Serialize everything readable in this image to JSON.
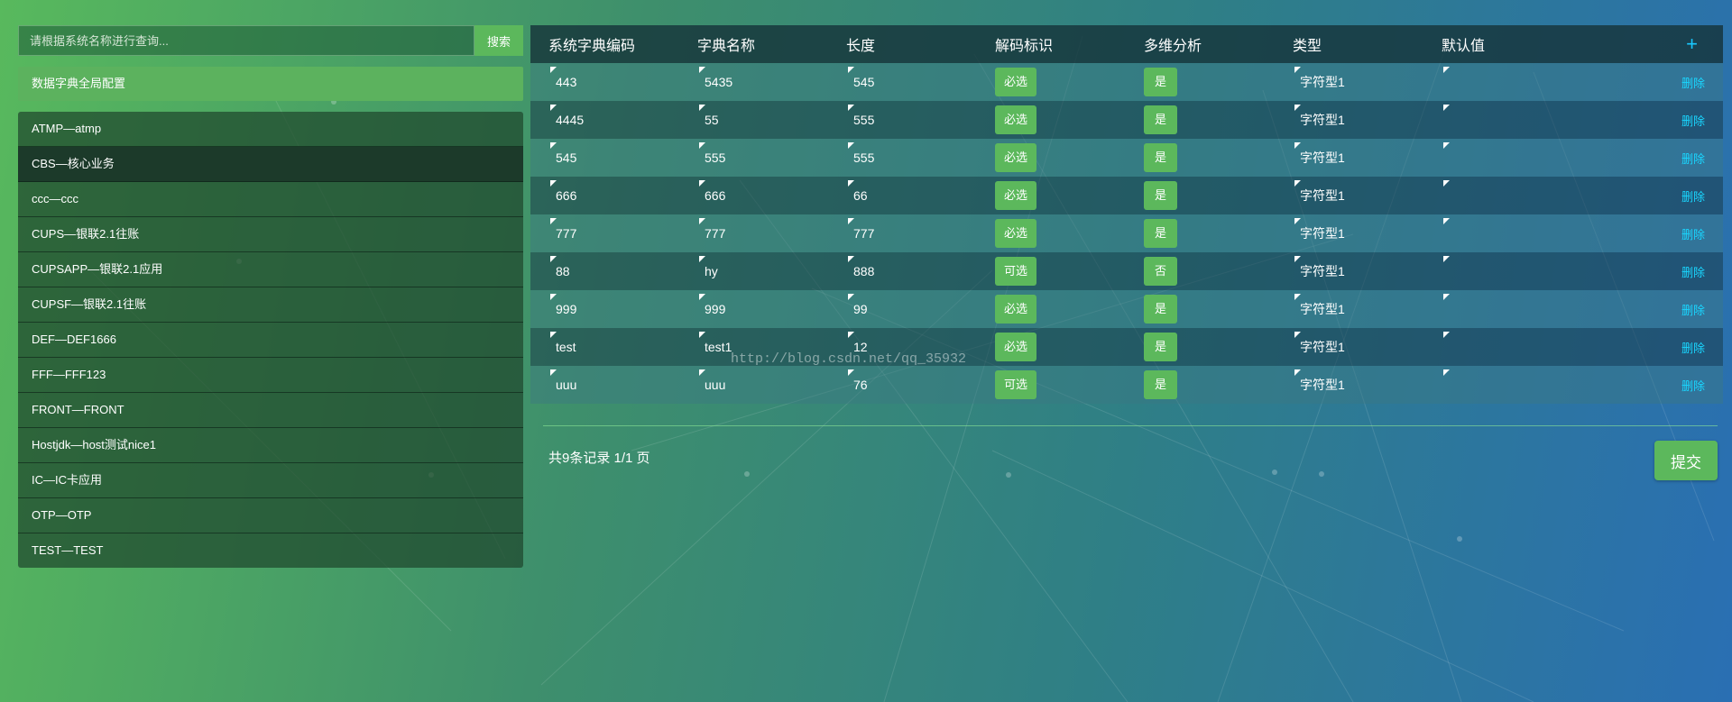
{
  "search": {
    "placeholder": "请根据系统名称进行查询...",
    "button_label": "搜索"
  },
  "global_config_label": "数据字典全局配置",
  "systems": [
    {
      "label": "ATMP—atmp",
      "active": false
    },
    {
      "label": "CBS—核心业务",
      "active": true
    },
    {
      "label": "ccc—ccc",
      "active": false
    },
    {
      "label": "CUPS—银联2.1往账",
      "active": false
    },
    {
      "label": "CUPSAPP—银联2.1应用",
      "active": false
    },
    {
      "label": "CUPSF—银联2.1往账",
      "active": false
    },
    {
      "label": "DEF—DEF1666",
      "active": false
    },
    {
      "label": "FFF—FFF123",
      "active": false
    },
    {
      "label": "FRONT—FRONT",
      "active": false
    },
    {
      "label": "Hostjdk—host测试nice1",
      "active": false
    },
    {
      "label": "IC—IC卡应用",
      "active": false
    },
    {
      "label": "OTP—OTP",
      "active": false
    },
    {
      "label": "TEST—TEST",
      "active": false
    }
  ],
  "table": {
    "headers": [
      "系统字典编码",
      "字典名称",
      "长度",
      "解码标识",
      "多维分析",
      "类型",
      "默认值"
    ],
    "add_label": "+",
    "delete_label": "删除",
    "rows": [
      {
        "code": "443",
        "name": "5435",
        "length": "545",
        "decode": "必选",
        "multi": "是",
        "type": "字符型1",
        "default": ""
      },
      {
        "code": "4445",
        "name": "55",
        "length": "555",
        "decode": "必选",
        "multi": "是",
        "type": "字符型1",
        "default": ""
      },
      {
        "code": "545",
        "name": "555",
        "length": "555",
        "decode": "必选",
        "multi": "是",
        "type": "字符型1",
        "default": ""
      },
      {
        "code": "666",
        "name": "666",
        "length": "66",
        "decode": "必选",
        "multi": "是",
        "type": "字符型1",
        "default": ""
      },
      {
        "code": "777",
        "name": "777",
        "length": "777",
        "decode": "必选",
        "multi": "是",
        "type": "字符型1",
        "default": ""
      },
      {
        "code": "88",
        "name": "hy",
        "length": "888",
        "decode": "可选",
        "multi": "否",
        "type": "字符型1",
        "default": ""
      },
      {
        "code": "999",
        "name": "999",
        "length": "99",
        "decode": "必选",
        "multi": "是",
        "type": "字符型1",
        "default": ""
      },
      {
        "code": "test",
        "name": "test1",
        "length": "12",
        "decode": "必选",
        "multi": "是",
        "type": "字符型1",
        "default": ""
      },
      {
        "code": "uuu",
        "name": "uuu",
        "length": "76",
        "decode": "可选",
        "multi": "是",
        "type": "字符型1",
        "default": ""
      }
    ]
  },
  "pagination_text": "共9条记录 1/1 页",
  "submit_label": "提交",
  "watermark": "http://blog.csdn.net/qq_35932",
  "colors": {
    "accent_green": "#5cb85c",
    "delete_link": "#19d6ff"
  }
}
